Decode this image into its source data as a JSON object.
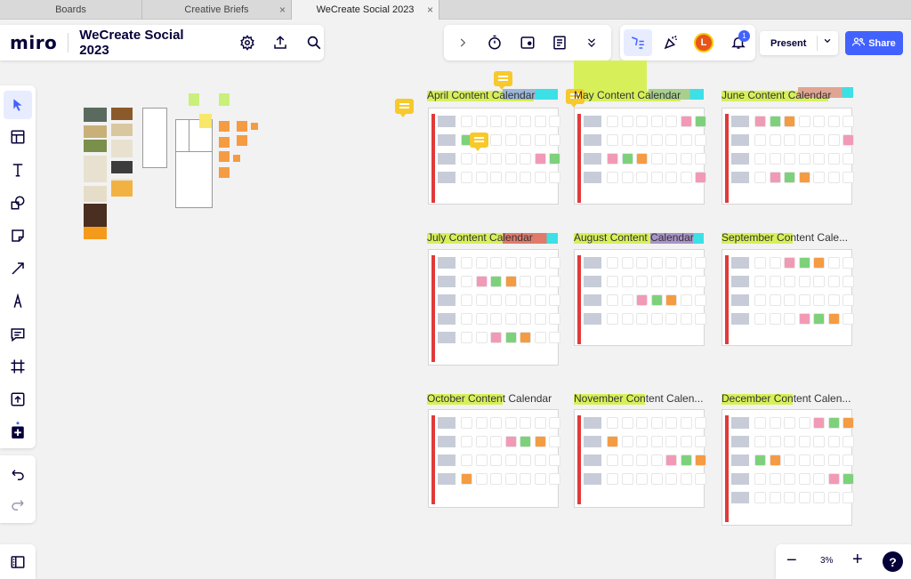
{
  "tabs": [
    {
      "label": "Boards"
    },
    {
      "label": "Creative Briefs"
    },
    {
      "label": "WeCreate Social 2023"
    }
  ],
  "app": {
    "logo": "miro",
    "board_title": "WeCreate Social 2023"
  },
  "topbar": {
    "present_label": "Present",
    "share_label": "Share",
    "avatar_initial": "L",
    "notification_count": "1"
  },
  "zoom": {
    "level": "3%",
    "help": "?"
  },
  "calendars": [
    {
      "title": "April Content Calendar"
    },
    {
      "title": "May Content Calendar"
    },
    {
      "title": "June Content Calendar"
    },
    {
      "title": "July Content Calendar"
    },
    {
      "title": "August Content Calendar"
    },
    {
      "title": "September Content Cale..."
    },
    {
      "title": "October Content Calendar"
    },
    {
      "title": "November Content Calen..."
    },
    {
      "title": "December Content Calen..."
    }
  ],
  "colors": {
    "accent": "#4262ff",
    "highlight": "#d7f05a",
    "sticky_orange": "#f59b42",
    "comment_yellow": "#f7c92a",
    "calendar_bar": "#e03a3a"
  },
  "icons": [
    "settings-icon",
    "upload-icon",
    "search-icon",
    "chevron-right-icon",
    "timer-icon",
    "voting-icon",
    "notes-icon",
    "chevrons-down-icon",
    "reactions-icon",
    "celebrate-icon",
    "bell-icon",
    "share-people-icon",
    "select-icon",
    "templates-icon",
    "text-icon",
    "shapes-icon",
    "sticky-note-icon",
    "line-icon",
    "pen-icon",
    "comment-icon",
    "frame-icon",
    "upload-tool-icon",
    "add-apps-icon",
    "undo-icon",
    "redo-icon",
    "panel-icon"
  ]
}
